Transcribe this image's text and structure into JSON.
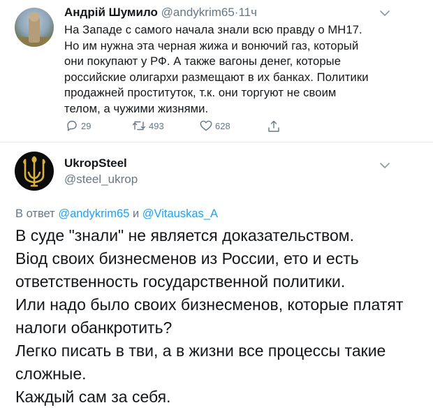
{
  "tweet1": {
    "author_name": "Андрій Шумило",
    "author_handle": "@andykrim65",
    "separator": "·",
    "time": "11ч",
    "text_lines": [
      "На Западе с самого начала знали всю правду о МН17.",
      "Но им нужна эта черная жижа и вонючий газ, который",
      "они покупают у РФ. А также вагоны денег, которые",
      "российские олигархи размещают в их банках. Политики",
      "продажней проституток, т.к. они торгуют не своим",
      "телом, а чужими жизнями."
    ],
    "replies_count": "29",
    "retweets_count": "493",
    "likes_count": "628"
  },
  "tweet2": {
    "author_name": "UkropSteel",
    "author_handle": "@steel_ukrop",
    "reply_prefix": "В ответ",
    "reply_mention_1": "@andykrim65",
    "reply_conjunction": "и",
    "reply_mention_2": "@Vitauskas_A",
    "text_lines": [
      "В суде \"знали\" не является доказательством.",
      "Віод своих бизнесменов из России, ето и есть",
      "ответственность государственной политики.",
      "Или надо было своих бизнесменов, которые платят",
      "налоги обанкротить?",
      "Легко писать в тви, а в жизни все процессы такие",
      "сложные.",
      "Каждый сам за себя."
    ]
  },
  "colors": {
    "text": "#14171a",
    "secondary": "#657786",
    "link": "#1da1f2",
    "divider": "#e6ecf0",
    "logo_gold": "#d9b13b"
  },
  "icons": {
    "reply": "reply-icon",
    "retweet": "retweet-icon",
    "like": "like-icon",
    "share": "share-icon",
    "more": "chevron-down-icon"
  }
}
